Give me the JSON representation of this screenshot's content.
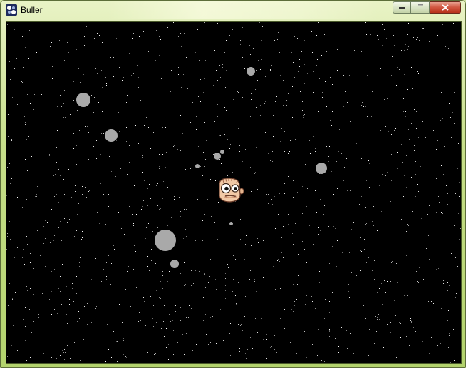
{
  "window": {
    "title": "Buller",
    "app_icon": "app-logo-icon",
    "buttons": {
      "minimize_icon": "minimize-icon",
      "maximize_icon": "maximize-icon",
      "close_icon": "close-icon"
    }
  },
  "game": {
    "background_color": "#000000",
    "bubble_color": "#a9a9a9",
    "star_color": "#ffffff",
    "player_icon": "face-character-icon"
  }
}
